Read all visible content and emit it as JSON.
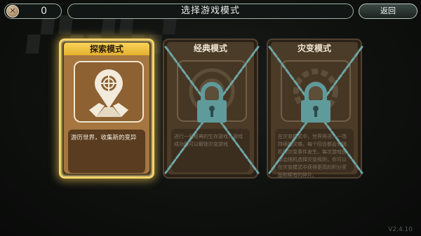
{
  "topbar": {
    "coin_value": "0",
    "title": "选择游戏模式",
    "back_label": "返回"
  },
  "cards": [
    {
      "title": "探索模式",
      "description": "游历世界，收集新的变异",
      "icon": "map-pin-icon",
      "locked": false,
      "selected": true
    },
    {
      "title": "经典模式",
      "description": "进行一局经典的生存游戏，游戏成功后可以解锁灾变游戏",
      "icon": "globe-icon",
      "locked": true,
      "selected": false
    },
    {
      "title": "灾变模式",
      "description": "在灾变模式中，世界将进入一场持续的灾难，每个回合都会有随机的灾变事件发生。每次游戏前都会随机选择灾变规则，你可以在灾变模式中获得更高的积分奖励和稀有的碎片。",
      "icon": "gear-icon",
      "locked": true,
      "selected": false
    }
  ],
  "version": "V2.4.10",
  "colors": {
    "selected_border": "#f3d36b",
    "chain": "#6fa6a6",
    "lock": "#5f9b9b"
  }
}
